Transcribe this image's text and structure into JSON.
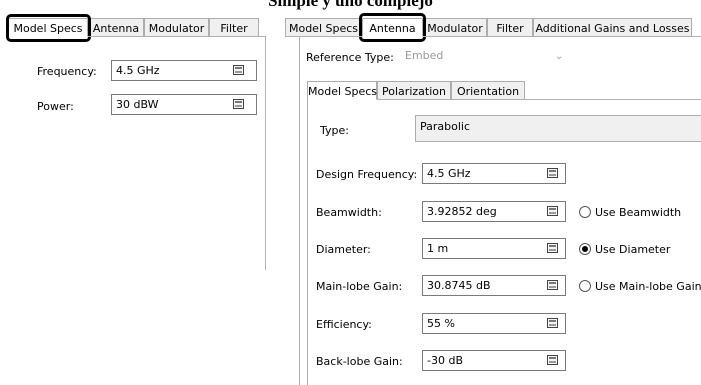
{
  "title": "Simple y uno complejo",
  "left": {
    "tabs": [
      {
        "label": "Model Specs"
      },
      {
        "label": "Antenna"
      },
      {
        "label": "Modulator"
      },
      {
        "label": "Filter"
      }
    ],
    "frequency_label": "Frequency:",
    "frequency_value": "4.5 GHz",
    "power_label": "Power:",
    "power_value": "30 dBW"
  },
  "right": {
    "tabs": [
      {
        "label": "Model Specs"
      },
      {
        "label": "Antenna"
      },
      {
        "label": "Modulator"
      },
      {
        "label": "Filter"
      },
      {
        "label": "Additional Gains and Losses"
      }
    ],
    "reference_type_label": "Reference Type:",
    "reference_type_value": "Embed",
    "subtabs": [
      {
        "label": "Model Specs"
      },
      {
        "label": "Polarization"
      },
      {
        "label": "Orientation"
      }
    ],
    "type_label": "Type:",
    "type_value": "Parabolic",
    "design_frequency_label": "Design Frequency:",
    "design_frequency_value": "4.5 GHz",
    "beamwidth_label": "Beamwidth:",
    "beamwidth_value": "3.92852 deg",
    "use_beamwidth_label": "Use Beamwidth",
    "diameter_label": "Diameter:",
    "diameter_value": "1 m",
    "use_diameter_label": "Use Diameter",
    "mainlobe_gain_label": "Main-lobe Gain:",
    "mainlobe_gain_value": "30.8745 dB",
    "use_mainlobe_gain_label": "Use Main-lobe Gain",
    "efficiency_label": "Efficiency:",
    "efficiency_value": "55 %",
    "backlobe_gain_label": "Back-lobe Gain:",
    "backlobe_gain_value": "-30 dB",
    "selected_mode": "Use Diameter"
  },
  "icons": {
    "calculator": "calculator-icon",
    "dropdown": "chevron-down-icon"
  }
}
